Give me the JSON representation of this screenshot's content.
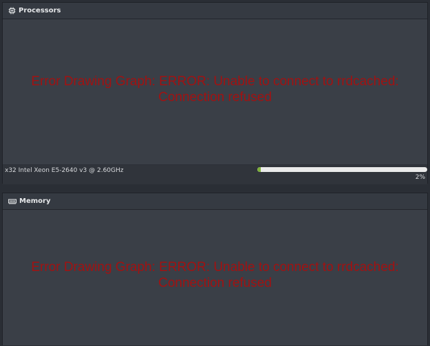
{
  "colors": {
    "panel_bg": "#353a42",
    "graph_bg": "#3a3f47",
    "error_text": "#a11212",
    "progress_fill": "#7fb23a",
    "progress_track": "#eaeaea"
  },
  "panels": [
    {
      "title": "Processors",
      "icon": "cpu-chip-icon",
      "error_line1": "Error Drawing Graph: ERROR: Unable to connect to rrdcached:",
      "error_line2": "Connection refused",
      "cpu_label": "x32 Intel Xeon E5-2640 v3 @ 2.60GHz",
      "usage_fraction": 0.02,
      "usage_label": "2%"
    },
    {
      "title": "Memory",
      "icon": "memory-module-icon",
      "error_line1": "Error Drawing Graph: ERROR: Unable to connect to rrdcached:",
      "error_line2": "Connection refused"
    }
  ]
}
